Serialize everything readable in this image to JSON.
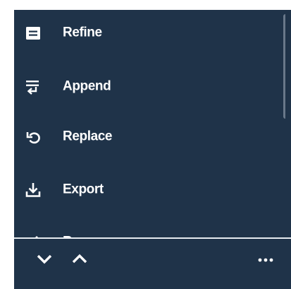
{
  "menu": {
    "items": [
      {
        "label": "Refine",
        "icon": "refine-icon"
      },
      {
        "label": "Append",
        "icon": "append-icon"
      },
      {
        "label": "Replace",
        "icon": "replace-icon"
      },
      {
        "label": "Export",
        "icon": "export-icon"
      },
      {
        "label": "R",
        "icon": "rename-icon"
      }
    ]
  },
  "footer": {
    "buttons": [
      {
        "icon": "chevron-down-icon"
      },
      {
        "icon": "chevron-up-icon"
      },
      {
        "icon": "more-horizontal-icon"
      }
    ]
  },
  "colors": {
    "panel_background": "#1f3349",
    "text": "#ffffff",
    "divider": "#e6ebf0",
    "scrollbar_thumb": "#69788a"
  }
}
